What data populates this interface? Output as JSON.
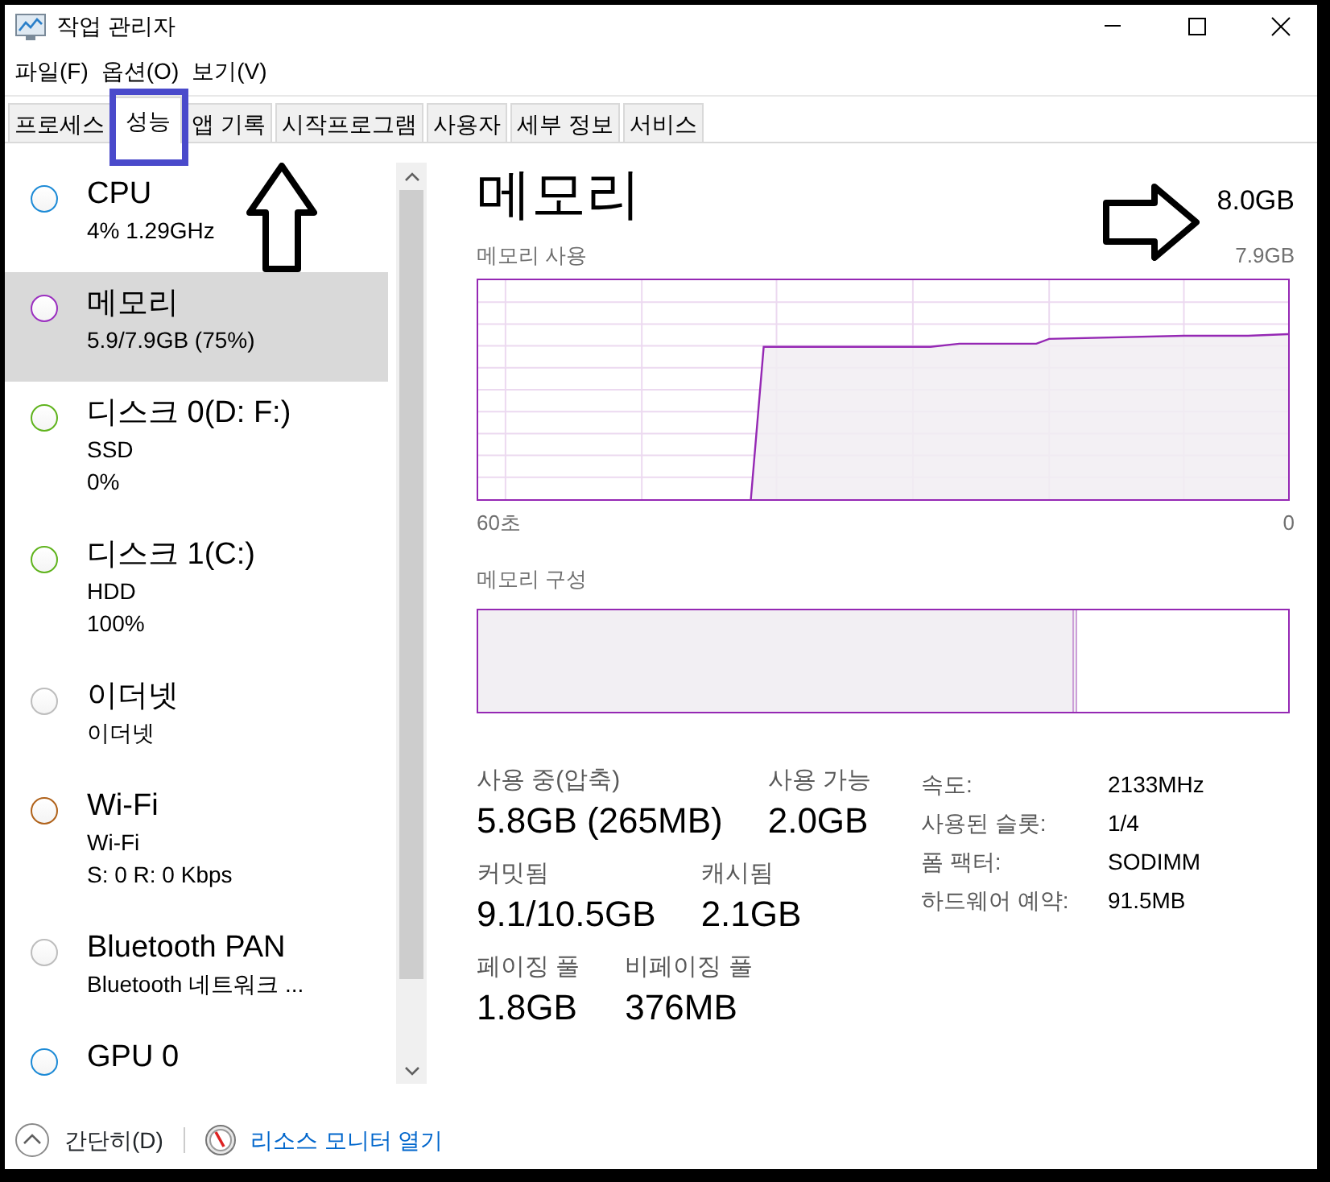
{
  "window": {
    "title": "작업 관리자"
  },
  "menu": [
    "파일(F)",
    "옵션(O)",
    "보기(V)"
  ],
  "tabs": [
    {
      "label": "프로세스",
      "selected": false
    },
    {
      "label": "성능",
      "selected": true
    },
    {
      "label": "앱 기록",
      "selected": false
    },
    {
      "label": "시작프로그램",
      "selected": false
    },
    {
      "label": "사용자",
      "selected": false
    },
    {
      "label": "세부 정보",
      "selected": false
    },
    {
      "label": "서비스",
      "selected": false
    }
  ],
  "sidebar": {
    "items": [
      {
        "name": "CPU",
        "lines": [
          "4% 1.29GHz"
        ],
        "color": "#1c8ad6",
        "selected": false
      },
      {
        "name": "메모리",
        "lines": [
          "5.9/7.9GB (75%)"
        ],
        "color": "#9b2fc0",
        "selected": true
      },
      {
        "name": "디스크 0(D: F:)",
        "lines": [
          "SSD",
          "0%"
        ],
        "color": "#5fb31c",
        "selected": false
      },
      {
        "name": "디스크 1(C:)",
        "lines": [
          "HDD",
          "100%"
        ],
        "color": "#5fb31c",
        "selected": false
      },
      {
        "name": "이더넷",
        "lines": [
          "이더넷"
        ],
        "color": "#bdbdbd",
        "selected": false
      },
      {
        "name": "Wi-Fi",
        "lines": [
          "Wi-Fi",
          "S: 0 R: 0 Kbps"
        ],
        "color": "#b0621a",
        "selected": false
      },
      {
        "name": "Bluetooth PAN",
        "lines": [
          "Bluetooth 네트워크 ..."
        ],
        "color": "#bdbdbd",
        "selected": false
      },
      {
        "name": "GPU 0",
        "color": "#1c8ad6",
        "selected": false
      }
    ]
  },
  "detail": {
    "title": "메모리",
    "total": "8.0GB",
    "usage_graph": {
      "label": "메모리 사용",
      "max": "7.9GB",
      "x_start": "60초",
      "x_end": "0"
    },
    "composition": {
      "label": "메모리 구성",
      "level": 0.74
    },
    "stats": [
      [
        {
          "label": "사용 중(압축)",
          "value": "5.8GB (265MB)"
        },
        {
          "label": "사용 가능",
          "value": "2.0GB"
        }
      ],
      [
        {
          "label": "커밋됨",
          "value": "9.1/10.5GB"
        },
        {
          "label": "캐시됨",
          "value": "2.1GB"
        }
      ],
      [
        {
          "label": "페이징 풀",
          "value": "1.8GB"
        },
        {
          "label": "비페이징 풀",
          "value": "376MB"
        }
      ]
    ],
    "specs": [
      {
        "label": "속도:",
        "value": "2133MHz"
      },
      {
        "label": "사용된 슬롯:",
        "value": "1/4"
      },
      {
        "label": "폼 팩터:",
        "value": "SODIMM"
      },
      {
        "label": "하드웨어 예약:",
        "value": "91.5MB"
      }
    ]
  },
  "footer": {
    "collapse": "간단히(D)",
    "link": "리소스 모니터 열기"
  },
  "annotations": [
    {
      "kind": "box"
    },
    {
      "kind": "arrow-up"
    },
    {
      "kind": "arrow-right"
    }
  ]
}
